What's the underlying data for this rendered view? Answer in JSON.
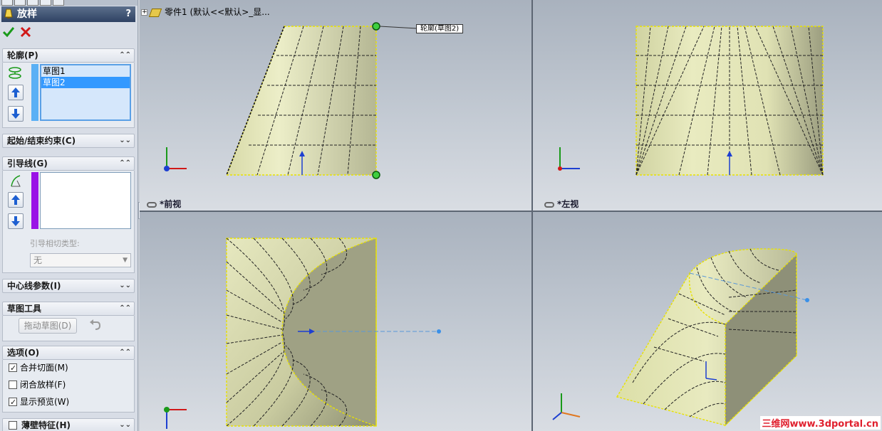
{
  "property_manager": {
    "title": "放样",
    "help": "?",
    "profile_group": {
      "title": "轮廓(P)",
      "items": [
        "草图1",
        "草图2"
      ],
      "selected_index": 1
    },
    "constraint_group": {
      "title": "起始/结束约束(C)"
    },
    "guide_group": {
      "title": "引导线(G)",
      "tangency_label": "引导相切类型:",
      "tangency_value": "无"
    },
    "centerline_group": {
      "title": "中心线参数(I)"
    },
    "sketch_tools_group": {
      "title": "草图工具",
      "drag_sketch_label": "拖动草图(D)"
    },
    "options_group": {
      "title": "选项(O)",
      "checkboxes": [
        {
          "label": "合并切面(M)",
          "checked": true
        },
        {
          "label": "闭合放样(F)",
          "checked": false
        },
        {
          "label": "显示预览(W)",
          "checked": true
        }
      ]
    },
    "thin_feature": {
      "label": "薄壁特征(H)",
      "checked": false
    }
  },
  "feature_tree": {
    "node_label": "零件1 (默认<<默认>_显..."
  },
  "viewports": {
    "front": {
      "label": "*前视",
      "callout": "轮廓(草图2)"
    },
    "left": {
      "label": "*左视"
    }
  },
  "watermark": "三维网www.3dportal.cn",
  "colors": {
    "surface": "#d6d9a8",
    "profile_bar": "#5ab0f5",
    "guide_bar": "#9a12e6",
    "ok_green": "#1a9a1a",
    "cancel_red": "#d01818"
  }
}
